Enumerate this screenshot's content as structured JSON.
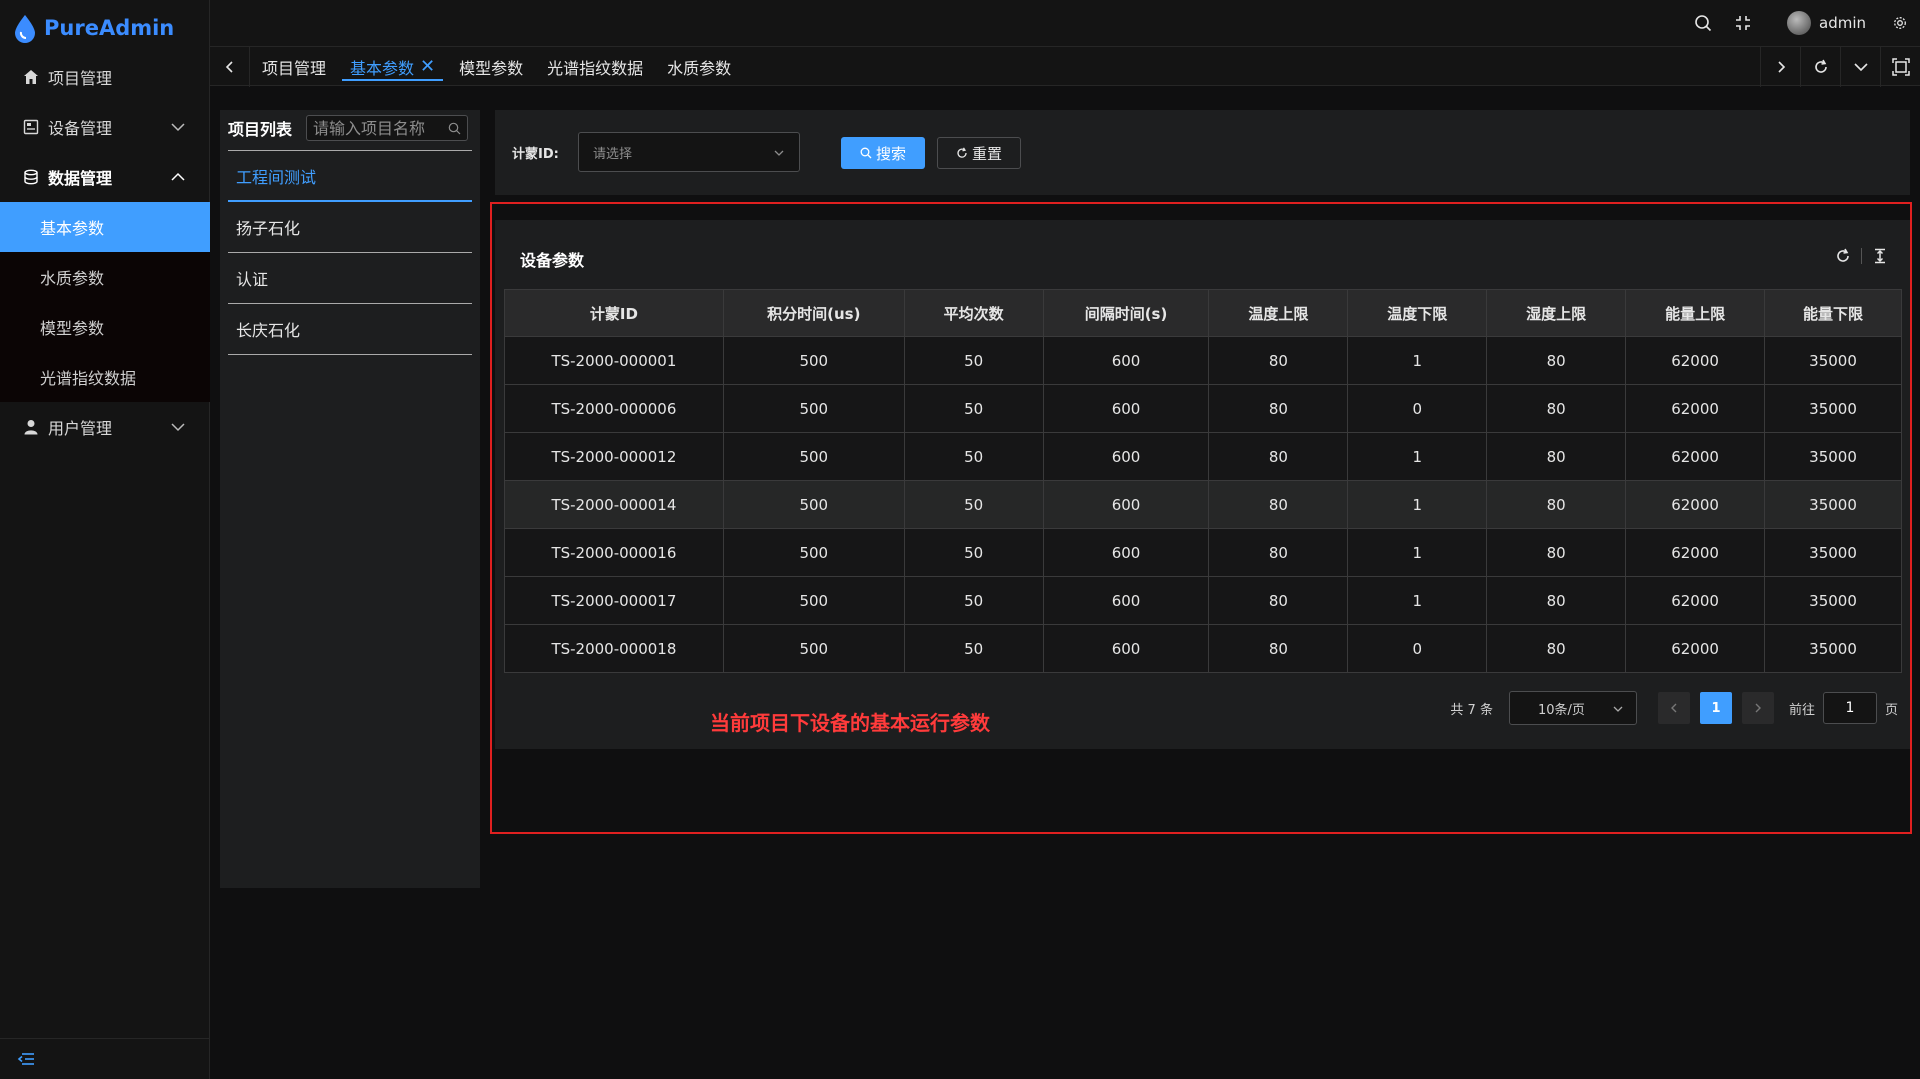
{
  "app": {
    "logo_text": "PureAdmin"
  },
  "sidebar": {
    "items": [
      {
        "label": "项目管理",
        "icon": "home-icon"
      },
      {
        "label": "设备管理",
        "icon": "device-icon"
      },
      {
        "label": "数据管理",
        "icon": "database-icon"
      },
      {
        "label": "用户管理",
        "icon": "user-icon"
      }
    ],
    "submenu": [
      {
        "label": "基本参数",
        "active": true
      },
      {
        "label": "水质参数"
      },
      {
        "label": "模型参数"
      },
      {
        "label": "光谱指纹数据"
      }
    ]
  },
  "topbar": {
    "username": "admin"
  },
  "tabs": [
    {
      "label": "项目管理"
    },
    {
      "label": "基本参数",
      "active": true
    },
    {
      "label": "模型参数"
    },
    {
      "label": "光谱指纹数据"
    },
    {
      "label": "水质参数"
    }
  ],
  "project_panel": {
    "title": "项目列表",
    "search_placeholder": "请输入项目名称",
    "items": [
      {
        "label": "工程间测试",
        "active": true
      },
      {
        "label": "扬子石化"
      },
      {
        "label": "认证"
      },
      {
        "label": "长庆石化"
      }
    ]
  },
  "filter": {
    "label": "计蒙ID:",
    "select_placeholder": "请选择",
    "search_label": "搜索",
    "reset_label": "重置"
  },
  "table": {
    "title": "设备参数",
    "columns": [
      "计蒙ID",
      "积分时间(us)",
      "平均次数",
      "间隔时间(s)",
      "温度上限",
      "温度下限",
      "湿度上限",
      "能量上限",
      "能量下限"
    ],
    "rows": [
      [
        "TS-2000-000001",
        "500",
        "50",
        "600",
        "80",
        "1",
        "80",
        "62000",
        "35000"
      ],
      [
        "TS-2000-000006",
        "500",
        "50",
        "600",
        "80",
        "0",
        "80",
        "62000",
        "35000"
      ],
      [
        "TS-2000-000012",
        "500",
        "50",
        "600",
        "80",
        "1",
        "80",
        "62000",
        "35000"
      ],
      [
        "TS-2000-000014",
        "500",
        "50",
        "600",
        "80",
        "1",
        "80",
        "62000",
        "35000"
      ],
      [
        "TS-2000-000016",
        "500",
        "50",
        "600",
        "80",
        "1",
        "80",
        "62000",
        "35000"
      ],
      [
        "TS-2000-000017",
        "500",
        "50",
        "600",
        "80",
        "1",
        "80",
        "62000",
        "35000"
      ],
      [
        "TS-2000-000018",
        "500",
        "50",
        "600",
        "80",
        "0",
        "80",
        "62000",
        "35000"
      ]
    ],
    "hover_row": 3
  },
  "note": "当前项目下设备的基本运行参数",
  "pagination": {
    "total": "共 7 条",
    "page_size": "10条/页",
    "current_page": "1",
    "goto_label": "前往",
    "goto_value": "1",
    "page_unit": "页"
  },
  "colors": {
    "accent": "#409eff",
    "highlight": "#e02020"
  }
}
